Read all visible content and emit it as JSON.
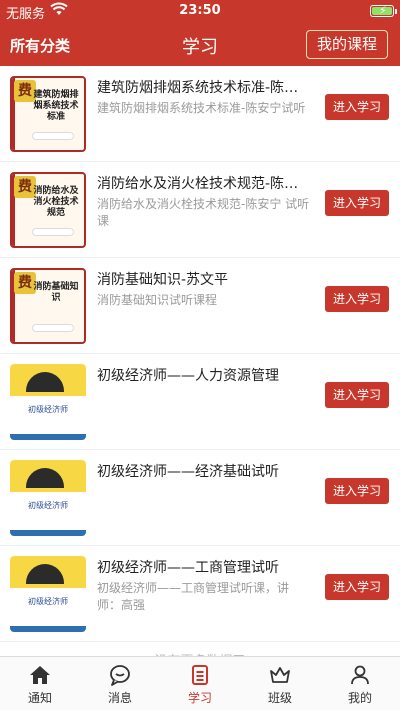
{
  "status": {
    "carrier": "无服务",
    "time": "23:50"
  },
  "nav": {
    "left": "所有分类",
    "title": "学习",
    "my_course": "我的课程"
  },
  "courses": [
    {
      "name": "建筑防烟排烟系统技术标准-陈安宁",
      "desc": "建筑防烟排烟系统技术标准-陈安宁试听",
      "button": "进入学习",
      "thumb_badge": "费",
      "thumb_text": "建筑防烟排烟系统技术标准",
      "thumb_style": "red"
    },
    {
      "name": "消防给水及消火栓技术规范-陈安宁",
      "desc": "消防给水及消火栓技术规范-陈安宁 试听课",
      "button": "进入学习",
      "thumb_badge": "费",
      "thumb_text": "消防给水及消火栓技术规范",
      "thumb_style": "red"
    },
    {
      "name": "消防基础知识-苏文平",
      "desc": "消防基础知识试听课程",
      "button": "进入学习",
      "thumb_badge": "费",
      "thumb_text": "消防基础知识",
      "thumb_style": "red"
    },
    {
      "name": "初级经济师——人力资源管理",
      "desc": "",
      "button": "进入学习",
      "thumb_text": "初级经济师",
      "thumb_style": "yellow"
    },
    {
      "name": "初级经济师——经济基础试听",
      "desc": "",
      "button": "进入学习",
      "thumb_text": "初级经济师",
      "thumb_style": "yellow"
    },
    {
      "name": "初级经济师——工商管理试听",
      "desc": "初级经济师——工商管理试听课，讲师：高强",
      "button": "进入学习",
      "thumb_text": "初级经济师",
      "thumb_style": "yellow"
    }
  ],
  "footer_hint": "没有更多数据了",
  "tabs": [
    {
      "label": "通知",
      "icon": "home-icon",
      "active": false
    },
    {
      "label": "消息",
      "icon": "chat-icon",
      "active": false
    },
    {
      "label": "学习",
      "icon": "study-icon",
      "active": true
    },
    {
      "label": "班级",
      "icon": "crown-icon",
      "active": false
    },
    {
      "label": "我的",
      "icon": "user-icon",
      "active": false
    }
  ],
  "colors": {
    "brand": "#c8372b",
    "battery": "#8ee36b"
  }
}
